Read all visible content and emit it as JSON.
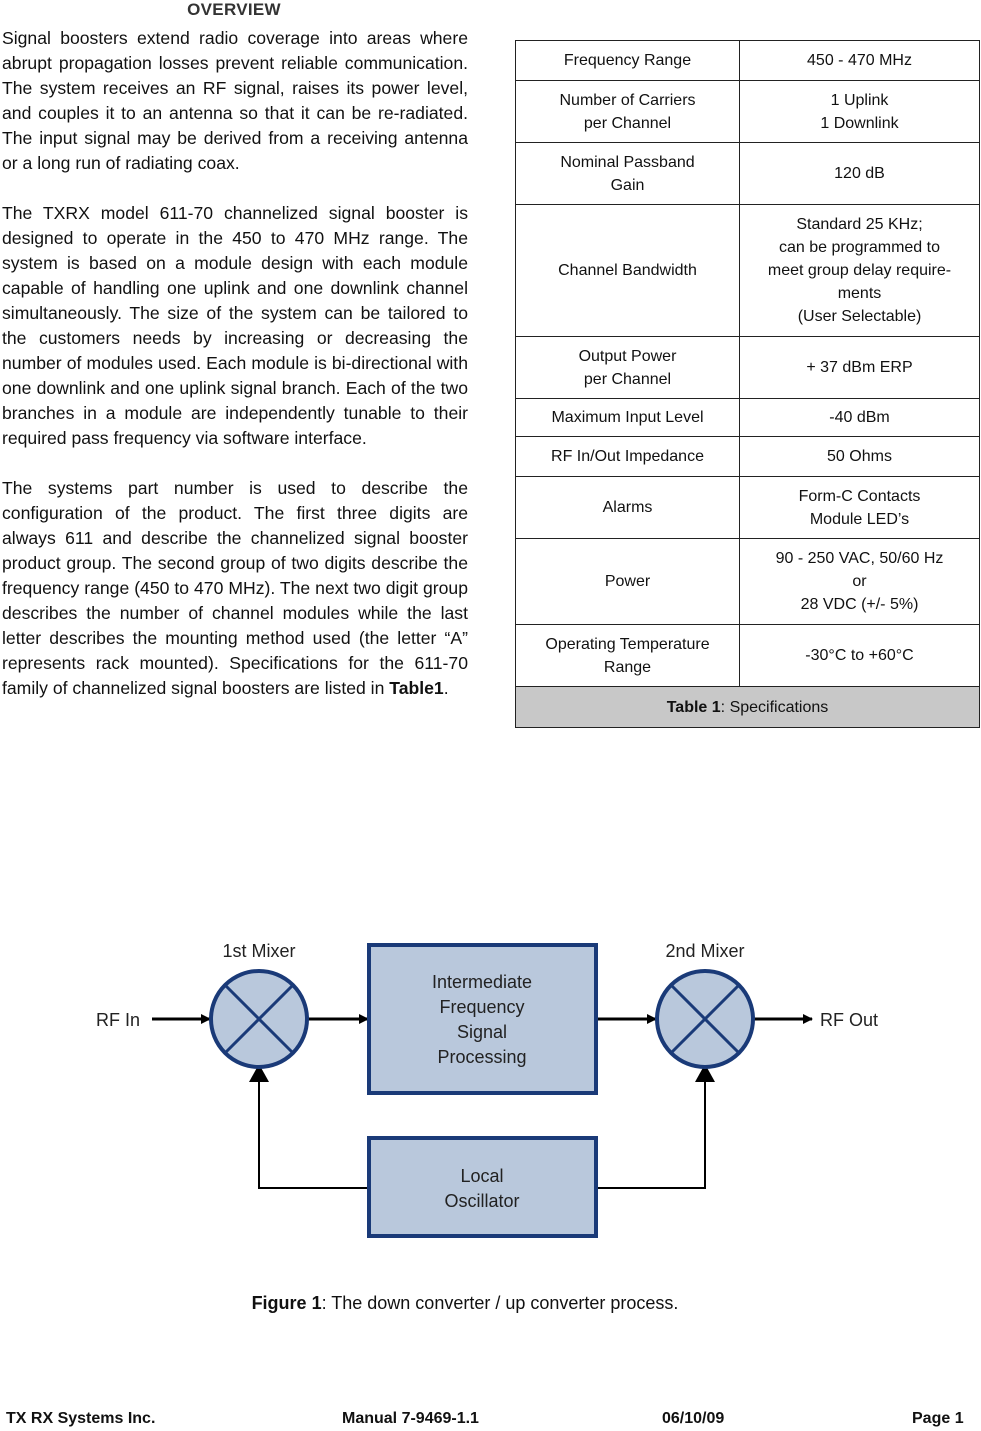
{
  "overview": {
    "heading": "OVERVIEW",
    "paragraph1": "Signal boosters extend radio coverage into areas where abrupt propagation losses prevent reliable communication. The system receives an RF signal, raises its power level, and couples it to an antenna so that it can be re-radiated. The input signal may be derived from a receiving antenna or a long run of radiating coax.",
    "paragraph2": "The TXRX model 611-70 channelized signal booster is designed to operate in the 450 to 470 MHz range. The system is based on a module design with each module capable of handling one uplink and one downlink channel simultaneously. The size of the system can be tailored to the cus­tomers needs by increasing or decreasing the number of modules used. Each module is bi-direc­tional with one downlink and one uplink signal branch. Each of the two branches in a module are independently tunable to their required pass fre­quency via software interface.",
    "paragraph3_text": "The systems part number is used to describe the configuration of the product. The first three digits are always 611 and describe the channelized sig­nal booster product group. The second group of two digits describe the frequency range (450 to 470 MHz). The next two digit group describes the num­ber of channel modules while the last letter describes the mounting method used (the letter “A” represents rack mounted). Specifications for the 611-70 family of channelized signal boosters are listed in ",
    "paragraph3_ref": "Table1",
    "paragraph3_end": "."
  },
  "spec_table": {
    "rows": [
      {
        "label": [
          "Frequency Range"
        ],
        "value": [
          "450 - 470 MHz"
        ]
      },
      {
        "label": [
          "Number of Carriers",
          "per Channel"
        ],
        "value": [
          "1 Uplink",
          "1 Downlink"
        ]
      },
      {
        "label": [
          "Nominal Passband",
          "Gain"
        ],
        "value": [
          "120 dB"
        ]
      },
      {
        "label": [
          "Channel Bandwidth"
        ],
        "value": [
          "Standard 25 KHz;",
          "can be programmed to",
          "meet group delay require-",
          "ments",
          "(User Selectable)"
        ]
      },
      {
        "label": [
          "Output Power",
          "per Channel"
        ],
        "value": [
          "+ 37 dBm ERP"
        ]
      },
      {
        "label": [
          "Maximum Input Level"
        ],
        "value": [
          "-40 dBm"
        ]
      },
      {
        "label": [
          "RF In/Out Impedance"
        ],
        "value": [
          "50 Ohms"
        ]
      },
      {
        "label": [
          "Alarms"
        ],
        "value": [
          "Form-C Contacts",
          "Module LED’s"
        ]
      },
      {
        "label": [
          "Power"
        ],
        "value": [
          "90 - 250 VAC, 50/60 Hz",
          "or",
          "28 VDC (+/- 5%)"
        ]
      },
      {
        "label": [
          "Operating Temperature",
          "Range"
        ],
        "value": [
          "-30°C to +60°C"
        ]
      }
    ],
    "caption_bold": "Table 1",
    "caption_text": ": Specifications"
  },
  "diagram": {
    "rf_in": "RF In",
    "rf_out": "RF Out",
    "mixer1": "1st Mixer",
    "mixer2": "2nd Mixer",
    "if_block": [
      "Intermediate",
      "Frequency",
      "Signal",
      "Processing"
    ],
    "lo_block": [
      "Local",
      "Oscillator"
    ],
    "colors": {
      "fill": "#b9c8dc",
      "stroke": "#1a3a78",
      "line": "#000000"
    }
  },
  "figure_caption": {
    "bold": "Figure 1",
    "text": ": The down converter / up converter process."
  },
  "footer": {
    "company": "TX RX Systems Inc.",
    "manual": "Manual 7-9469-1.1",
    "date": "06/10/09",
    "page": "Page 1"
  }
}
